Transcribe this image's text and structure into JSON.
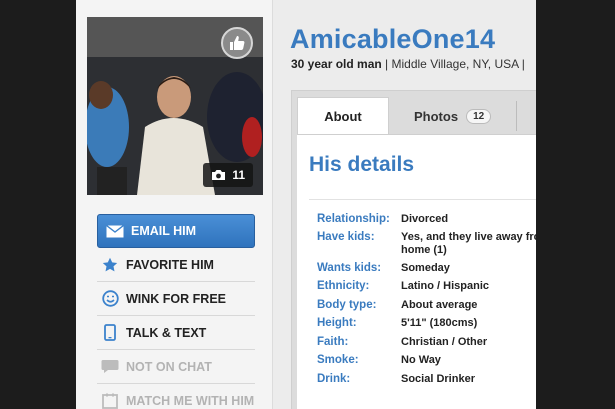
{
  "profile": {
    "username": "AmicableOne14",
    "subline_bold": "30 year old man",
    "subline_rest": " | Middle Village, NY, USA |",
    "photo_count": "11"
  },
  "actions": {
    "email": "EMAIL HIM",
    "favorite": "FAVORITE HIM",
    "wink": "WINK FOR FREE",
    "talk": "TALK & TEXT",
    "chat": "NOT ON CHAT",
    "match": "MATCH ME WITH HIM"
  },
  "tabs": {
    "about": "About",
    "photos": "Photos",
    "photos_count": "12"
  },
  "details": {
    "heading": "His details",
    "rows": [
      {
        "k": "Relationship:",
        "v": "Divorced"
      },
      {
        "k": "Have kids:",
        "v": "Yes, and they live away fro",
        "v2": "home (1)"
      },
      {
        "k": "Wants kids:",
        "v": "Someday"
      },
      {
        "k": "Ethnicity:",
        "v": "Latino / Hispanic"
      },
      {
        "k": "Body type:",
        "v": "About average"
      },
      {
        "k": "Height:",
        "v": "5'11\" (180cms)"
      },
      {
        "k": "Faith:",
        "v": "Christian / Other"
      },
      {
        "k": "Smoke:",
        "v": "No Way"
      },
      {
        "k": "Drink:",
        "v": "Social Drinker"
      }
    ]
  },
  "colors": {
    "accent": "#3a7bbf",
    "button": "#3b82cc"
  }
}
